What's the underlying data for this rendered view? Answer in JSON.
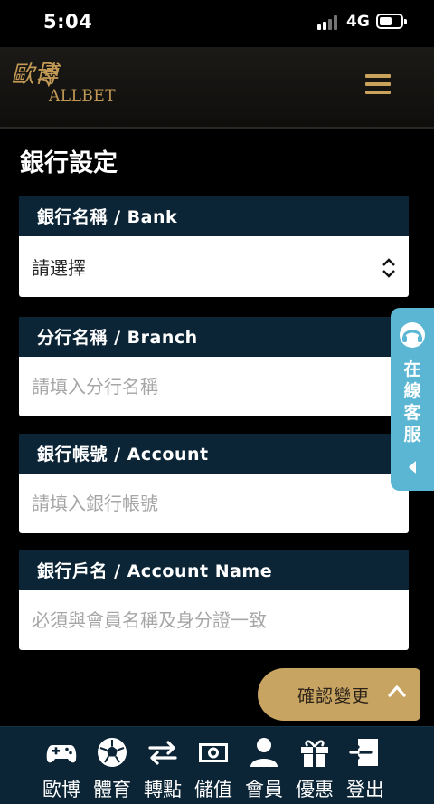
{
  "status_bar": {
    "time": "5:04",
    "network": "4G"
  },
  "header": {
    "brand_text": "ALLBET",
    "brand_glyph": "歐博"
  },
  "page": {
    "title": "銀行設定"
  },
  "form": {
    "bank": {
      "label": "銀行名稱 / Bank",
      "value": "請選擇"
    },
    "branch": {
      "label": "分行名稱 / Branch",
      "placeholder": "請填入分行名稱"
    },
    "account": {
      "label": "銀行帳號 / Account",
      "placeholder": "請填入銀行帳號"
    },
    "account_name": {
      "label": "銀行戶名 / Account Name",
      "placeholder": "必須與會員名稱及身分證一致"
    }
  },
  "customer_service": {
    "label": "在\n線\n客\n服"
  },
  "confirm_button": {
    "label": "確認變更"
  },
  "bottom_nav": [
    {
      "label": "歐博",
      "icon": "gamepad-icon"
    },
    {
      "label": "體育",
      "icon": "soccer-ball-icon"
    },
    {
      "label": "轉點",
      "icon": "transfer-icon"
    },
    {
      "label": "儲值",
      "icon": "deposit-icon"
    },
    {
      "label": "會員",
      "icon": "member-icon"
    },
    {
      "label": "優惠",
      "icon": "gift-icon"
    },
    {
      "label": "登出",
      "icon": "logout-icon"
    }
  ],
  "colors": {
    "accent_gold": "#c8a462",
    "nav_bg": "#0b2536",
    "cs_blue": "#5ab6d2"
  }
}
